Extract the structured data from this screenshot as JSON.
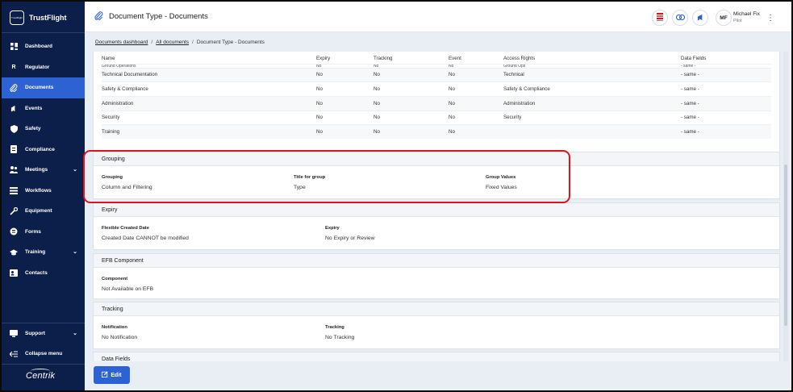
{
  "brand": {
    "logo_text": "TrustFlight",
    "name": "TrustFlight"
  },
  "nav": [
    {
      "label": "Dashboard",
      "icon": "dashboard-icon",
      "active": false
    },
    {
      "label": "Regulator",
      "icon": "regulator-icon",
      "active": false
    },
    {
      "label": "Documents",
      "icon": "paperclip-icon",
      "active": true
    },
    {
      "label": "Events",
      "icon": "megaphone-icon",
      "active": false
    },
    {
      "label": "Safety",
      "icon": "shield-icon",
      "active": false
    },
    {
      "label": "Compliance",
      "icon": "checklist-icon",
      "active": false
    },
    {
      "label": "Meetings",
      "icon": "people-icon",
      "active": false,
      "chevron": true
    },
    {
      "label": "Workflows",
      "icon": "stack-icon",
      "active": false
    },
    {
      "label": "Equipment",
      "icon": "wrench-icon",
      "active": false
    },
    {
      "label": "Forms",
      "icon": "forms-icon",
      "active": false
    },
    {
      "label": "Training",
      "icon": "graduation-cap-icon",
      "active": false,
      "chevron": true
    },
    {
      "label": "Contacts",
      "icon": "contacts-icon",
      "active": false
    }
  ],
  "sidebar_bottom": {
    "support": "Support",
    "collapse": "Collapse menu",
    "footer_logo": "Centrik"
  },
  "header": {
    "title": "Document Type - Documents",
    "user_initials": "MF",
    "user_name": "Michael Fix",
    "user_role": "Pilot"
  },
  "breadcrumb": {
    "item1": "Documents dashboard",
    "item2": "All documents",
    "current": "Document Type - Documents"
  },
  "access_table": {
    "columns": [
      "Name",
      "Expiry",
      "Tracking",
      "Event",
      "Access Rights",
      "Data Fields"
    ],
    "partial_row": [
      "Ground Operations",
      "No",
      "No",
      "No",
      "Ground Ops",
      "- same -"
    ],
    "rows": [
      [
        "Technical Documentation",
        "No",
        "No",
        "No",
        "Technical",
        "- same -"
      ],
      [
        "Safety & Compliance",
        "No",
        "No",
        "No",
        "Safety & Compliance",
        "- same -"
      ],
      [
        "Administration",
        "No",
        "No",
        "No",
        "Administration",
        "- same -"
      ],
      [
        "Security",
        "No",
        "No",
        "No",
        "Security",
        "- same -"
      ],
      [
        "Training",
        "No",
        "No",
        "No",
        "",
        "- same -"
      ]
    ]
  },
  "grouping": {
    "title": "Grouping",
    "fields": [
      {
        "label": "Grouping",
        "value": "Column and Filtering"
      },
      {
        "label": "Title for group",
        "value": "Type"
      },
      {
        "label": "Group Values",
        "value": "Fixed Values"
      }
    ]
  },
  "expiry": {
    "title": "Expiry",
    "fields": [
      {
        "label": "Flexible Created Date",
        "value": "Created Date CANNOT be modified"
      },
      {
        "label": "Expiry",
        "value": "No Expiry or Review"
      }
    ]
  },
  "efb": {
    "title": "EFB Component",
    "fields": [
      {
        "label": "Component",
        "value": "Not Available on EFB"
      }
    ]
  },
  "tracking": {
    "title": "Tracking",
    "fields": [
      {
        "label": "Notification",
        "value": "No Notification"
      },
      {
        "label": "Tracking",
        "value": "No Tracking"
      }
    ]
  },
  "data_fields": {
    "title": "Data Fields"
  },
  "footer": {
    "edit_label": "Edit"
  },
  "colors": {
    "sidebar": "#0c1e4a",
    "accent": "#2d62d2",
    "highlight": "#d9171b"
  }
}
